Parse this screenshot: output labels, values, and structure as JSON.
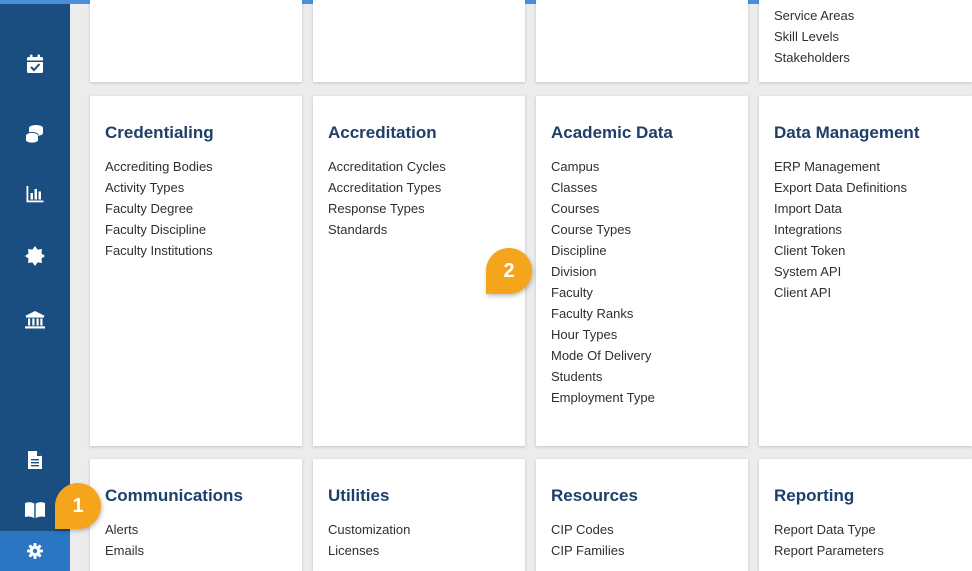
{
  "sidebar": {
    "items": [
      {
        "name": "calendar-check-icon"
      },
      {
        "name": "coins-icon"
      },
      {
        "name": "bar-chart-icon"
      },
      {
        "name": "badge-icon"
      },
      {
        "name": "institution-icon"
      },
      {
        "name": "document-icon"
      },
      {
        "name": "book-icon"
      },
      {
        "name": "settings-gear-icon",
        "active": true
      }
    ],
    "active_color": "#2a76c2",
    "background_color": "#1a4e80"
  },
  "top_card": {
    "items": [
      "Service Areas",
      "Skill Levels",
      "Stakeholders"
    ]
  },
  "cards": {
    "credentialing": {
      "title": "Credentialing",
      "items": [
        "Accrediting Bodies",
        "Activity Types",
        "Faculty Degree",
        "Faculty Discipline",
        "Faculty Institutions"
      ]
    },
    "accreditation": {
      "title": "Accreditation",
      "items": [
        "Accreditation Cycles",
        "Accreditation Types",
        "Response Types",
        "Standards"
      ]
    },
    "academic_data": {
      "title": "Academic Data",
      "items": [
        "Campus",
        "Classes",
        "Courses",
        "Course Types",
        "Discipline",
        "Division",
        "Faculty",
        "Faculty Ranks",
        "Hour Types",
        "Mode Of Delivery",
        "Students",
        "Employment Type"
      ]
    },
    "data_management": {
      "title": "Data Management",
      "items": [
        "ERP Management",
        "Export Data Definitions",
        "Import Data",
        "Integrations",
        "Client Token",
        "System API",
        "Client API"
      ]
    },
    "communications": {
      "title": "Communications",
      "items": [
        "Alerts",
        "Emails"
      ]
    },
    "utilities": {
      "title": "Utilities",
      "items": [
        "Customization",
        "Licenses"
      ]
    },
    "resources": {
      "title": "Resources",
      "items": [
        "CIP Codes",
        "CIP Families"
      ]
    },
    "reporting": {
      "title": "Reporting",
      "items": [
        "Report Data Type",
        "Report Parameters"
      ]
    }
  },
  "callouts": {
    "one": "1",
    "two": "2",
    "color": "#f4a51c"
  },
  "colors": {
    "heading": "#1e3f6a",
    "background": "#ececec"
  }
}
